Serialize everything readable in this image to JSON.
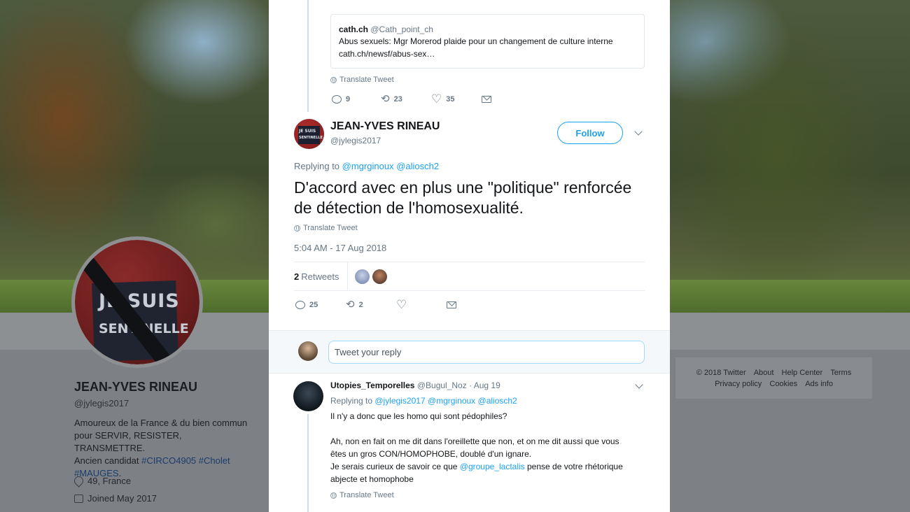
{
  "profile": {
    "avatar_line1": "JE SUIS",
    "avatar_line2": "SENTINELLE",
    "name": "JEAN-YVES RINEAU",
    "handle": "@jylegis2017",
    "bio_line1": "Amoureux de la France & du bien commun",
    "bio_line2": "pour SERVIR, RESISTER, TRANSMETTRE.",
    "bio_line3_prefix": "Ancien candidat ",
    "bio_tag1": "#CIRCO4905",
    "bio_tag2": "#Cholet",
    "bio_tag3": "#MAUGES",
    "bio_suffix": ".",
    "location": "49, France",
    "joined": "Joined May 2017"
  },
  "footer": {
    "copyright": "© 2018 Twitter",
    "about": "About",
    "help": "Help Center",
    "terms": "Terms",
    "privacy": "Privacy policy",
    "cookies": "Cookies",
    "ads": "Ads info"
  },
  "parent_tweet": {
    "quote_name": "cath.ch",
    "quote_handle": "@Cath_point_ch",
    "quote_text": "Abus sexuels: Mgr Morerod plaide pour un changement de culture interne",
    "quote_link": "cath.ch/newsf/abus-sex…",
    "translate": "Translate Tweet",
    "replies": "9",
    "retweets": "23",
    "likes": "35"
  },
  "main_tweet": {
    "avatar_line1": "JE SUIS",
    "avatar_line2": "SENTINELLE",
    "name": "JEAN-YVES RINEAU",
    "handle": "@jylegis2017",
    "follow_label": "Follow",
    "replying_prefix": "Replying to ",
    "mention1": "@mgrginoux",
    "mention2": "@aliosch2",
    "text": "D'accord avec en plus une \"politique\" renforcée de détection de l'homosexualité.",
    "translate": "Translate Tweet",
    "timestamp": "5:04 AM - 17 Aug 2018",
    "retweet_count": "2",
    "retweet_label": "Retweets",
    "replies": "25",
    "retweets": "2",
    "likes": ""
  },
  "composer": {
    "placeholder": "Tweet your reply"
  },
  "reply_tweet": {
    "name": "Utopies_Temporelles",
    "handle": "@Bugul_Noz",
    "date": "Aug 19",
    "replying_prefix": "Replying to ",
    "mention1": "@jylegis2017",
    "mention2": "@mgrginoux",
    "mention3": "@aliosch2",
    "line1": "Il n'y a donc que les homo qui sont pédophiles?",
    "line2": "Ah, non en fait on me dit dans l'oreillette que non, et on me dit aussi que vous",
    "line3": "êtes un gros CON/HOMOPHOBE, doublé d'un ignare.",
    "line4_prefix": "Je serais curieux de savoir ce que ",
    "line4_mention": "@groupe_lactalis",
    "line4_suffix": " pense de votre rhétorique",
    "line5": "abjecte et homophobe",
    "translate": "Translate Tweet"
  },
  "colors": {
    "accent": "#1da1f2",
    "thread_line": "#c4e2f4",
    "secondary_text": "#657786"
  }
}
